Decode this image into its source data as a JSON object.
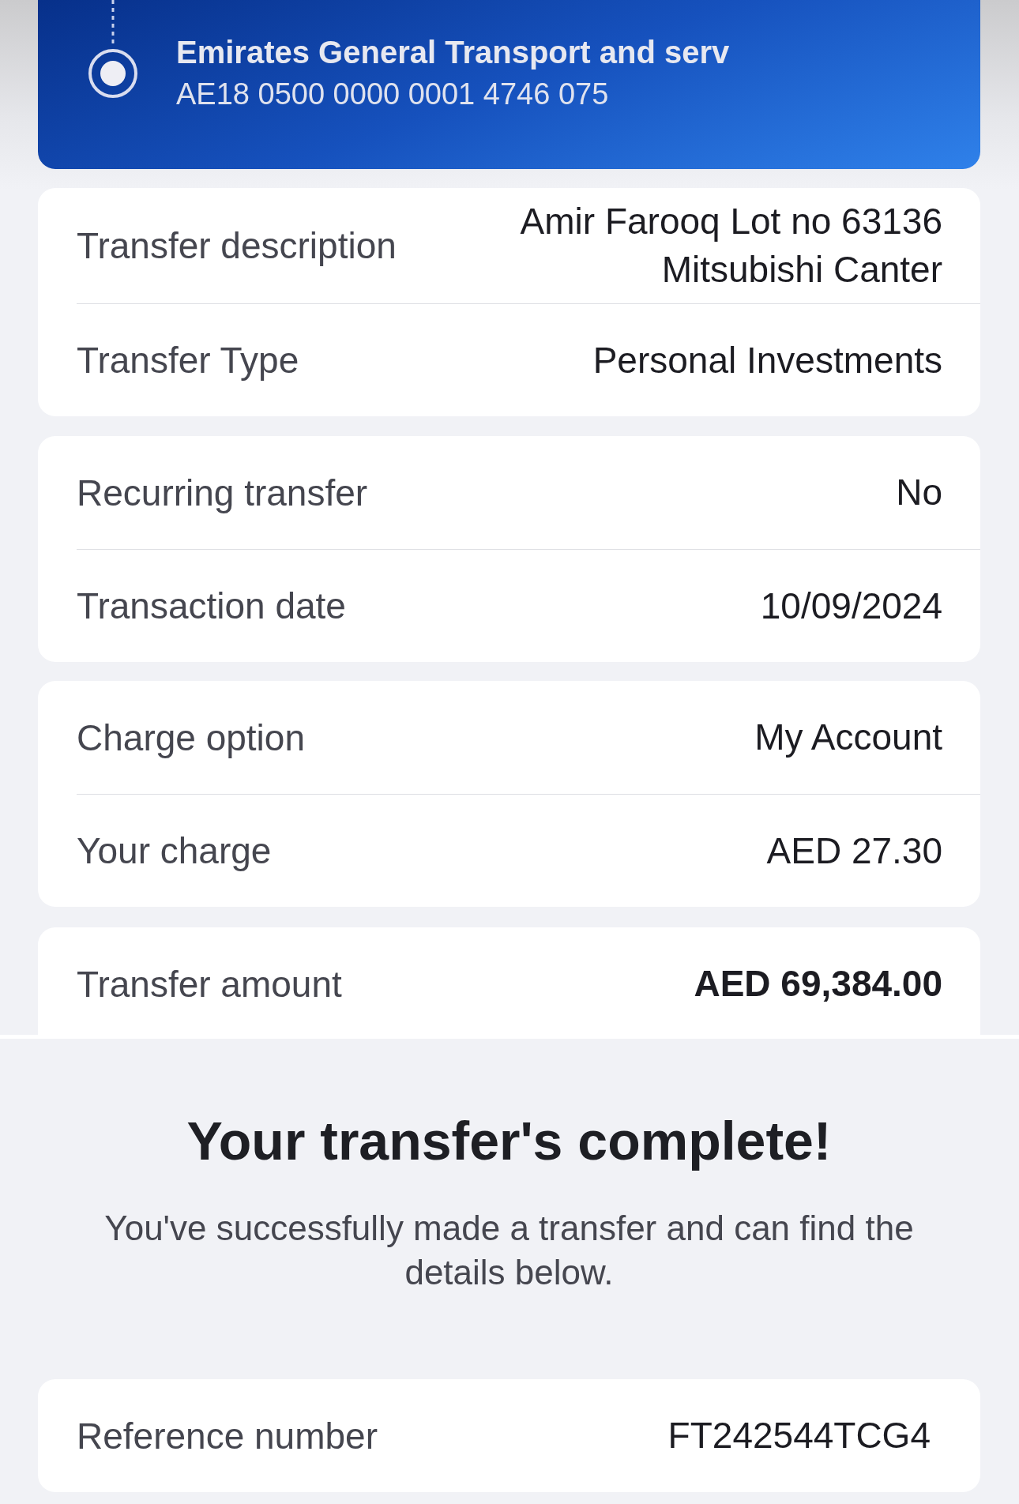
{
  "recipient": {
    "name": "Emirates General Transport and serv",
    "iban": "AE18 0500 0000 0001 4746 075"
  },
  "detail_cards": [
    {
      "rows": [
        {
          "label": "Transfer description",
          "value": "Amir Farooq Lot no 63136 Mitsubishi Canter",
          "kind": "plain"
        },
        {
          "label": "Transfer Type",
          "value": "Personal Investments",
          "kind": "plain"
        }
      ]
    },
    {
      "rows": [
        {
          "label": "Recurring transfer",
          "value": "No",
          "kind": "plain"
        },
        {
          "label": "Transaction date",
          "value": "10/09/2024",
          "kind": "plain"
        }
      ]
    },
    {
      "rows": [
        {
          "label": "Charge option",
          "value": "My Account",
          "kind": "plain"
        },
        {
          "label": "Your charge",
          "value": "AED 27.30",
          "kind": "plain"
        }
      ]
    },
    {
      "rows": [
        {
          "label": "Transfer amount",
          "value": "AED 69,384.00",
          "kind": "total"
        }
      ]
    }
  ],
  "confirmation": {
    "title": "Your transfer's complete!",
    "message": "You've successfully made a transfer and can find the details below.",
    "rows": [
      {
        "label": "Reference number",
        "value": "FT242544TCG4"
      }
    ]
  }
}
